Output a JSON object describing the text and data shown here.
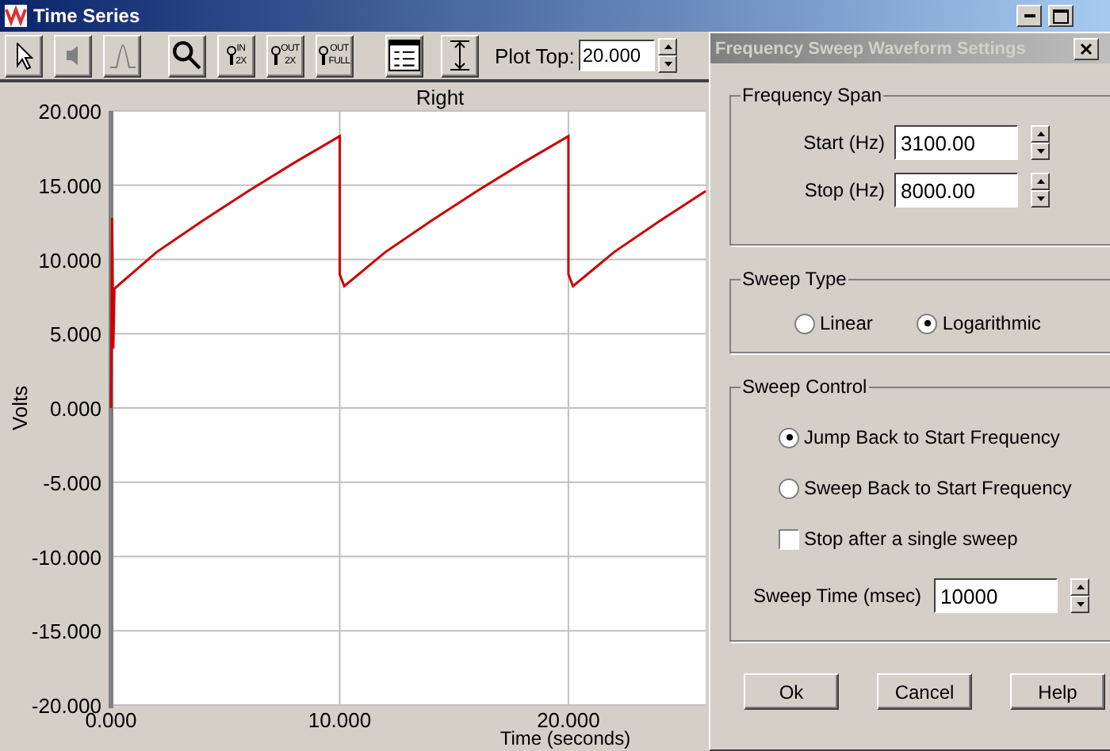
{
  "window": {
    "title": "Time Series"
  },
  "toolbar": {
    "buttons": [
      {
        "disabled": false
      },
      {
        "disabled": true
      },
      {
        "disabled": true
      },
      {
        "disabled": false
      },
      {
        "disabled": false,
        "lines": [
          "IN",
          "2X"
        ]
      },
      {
        "disabled": false,
        "lines": [
          "OUT",
          "2X"
        ]
      },
      {
        "disabled": false,
        "lines": [
          "OUT",
          "FULL"
        ]
      },
      {
        "disabled": false
      },
      {
        "disabled": false
      }
    ],
    "plot_top": {
      "label": "Plot Top:",
      "value": "20.000"
    }
  },
  "chart": {
    "chart_data": {
      "type": "line",
      "grid": true,
      "xlabel": "Time (seconds)",
      "ylabel": "Volts",
      "xlim": [
        0,
        26
      ],
      "ylim": [
        -20,
        20
      ],
      "xticks": [
        {
          "value": 0,
          "label": "0.000"
        },
        {
          "value": 10,
          "label": "10.000"
        },
        {
          "value": 20,
          "label": "20.000"
        }
      ],
      "yticks": [
        {
          "value": 20,
          "label": "20.000"
        },
        {
          "value": 15,
          "label": "15.000"
        },
        {
          "value": 10,
          "label": "10.000"
        },
        {
          "value": 5,
          "label": "5.000"
        },
        {
          "value": 0,
          "label": "0.000"
        },
        {
          "value": -5,
          "label": "-5.000"
        },
        {
          "value": -10,
          "label": "-10.000"
        },
        {
          "value": -15,
          "label": "-15.000"
        },
        {
          "value": -20,
          "label": "-20.000"
        }
      ],
      "x": [
        0,
        0.05,
        0.1,
        0.15,
        0.2,
        2,
        4,
        6,
        8,
        10,
        10,
        10.2,
        12,
        14,
        16,
        18,
        20,
        20,
        20.2,
        22,
        24,
        26
      ],
      "series": [
        {
          "name": "Right",
          "color": "#cc0000",
          "values": [
            0,
            12.8,
            4,
            8,
            8.1,
            10.5,
            12.6,
            14.6,
            16.5,
            18.3,
            9,
            8.2,
            10.5,
            12.6,
            14.6,
            16.5,
            18.3,
            9,
            8.2,
            10.5,
            12.6,
            14.6
          ]
        }
      ]
    }
  },
  "dialog": {
    "title": "Frequency Sweep Waveform Settings",
    "frequency_span": {
      "title": "Frequency Span",
      "fields": [
        {
          "label": "Start (Hz)",
          "value": "3100.00"
        },
        {
          "label": "Stop (Hz)",
          "value": "8000.00"
        }
      ]
    },
    "sweep_type": {
      "title": "Sweep Type",
      "options": [
        {
          "label": "Linear",
          "selected": false
        },
        {
          "label": "Logarithmic",
          "selected": true
        }
      ]
    },
    "sweep_control": {
      "title": "Sweep Control",
      "options": [
        {
          "label": "Jump Back to Start Frequency",
          "selected": true
        },
        {
          "label": "Sweep Back to Start Frequency",
          "selected": false
        }
      ],
      "single_sweep": {
        "label": "Stop after a single sweep",
        "checked": false
      },
      "sweep_time": {
        "label": "Sweep Time (msec)",
        "value": "10000"
      }
    },
    "buttons": [
      "Ok",
      "Cancel",
      "Help"
    ]
  }
}
